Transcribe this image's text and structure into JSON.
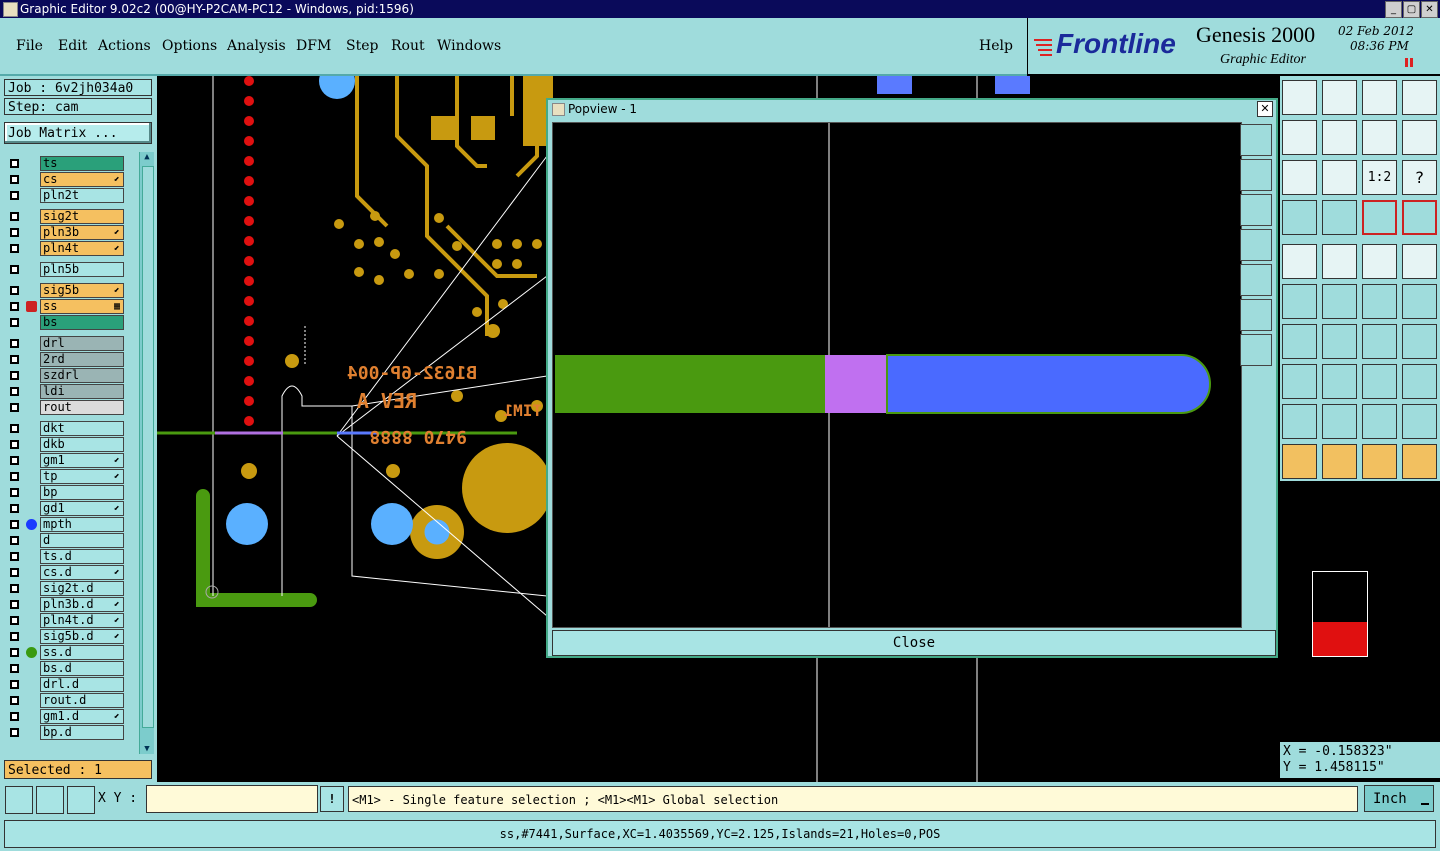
{
  "window": {
    "title": "Graphic Editor 9.02c2 (00@HY-P2CAM-PC12 - Windows, pid:1596)"
  },
  "menu": [
    "File",
    "Edit",
    "Actions",
    "Options",
    "Analysis",
    "DFM",
    "Step",
    "Rout",
    "Windows"
  ],
  "help_label": "Help",
  "brand": {
    "logo": "Frontline",
    "product": "Genesis 2000",
    "subtitle": "Graphic Editor",
    "date": "02 Feb 2012",
    "time": "08:36 PM"
  },
  "job": {
    "label": "Job : 6v2jh034a0",
    "step": "Step: cam",
    "matrix_button": "Job Matrix ..."
  },
  "layers": [
    {
      "name": "ts",
      "color": "#2aa07a",
      "flag": ""
    },
    {
      "name": "cs",
      "color": "#f5c060",
      "flag": "⬋"
    },
    {
      "name": "pln2t",
      "color": "#a8e4e4",
      "flag": ""
    },
    {
      "name": "sig2t",
      "color": "#f5c060",
      "flag": ""
    },
    {
      "name": "pln3b",
      "color": "#f5c060",
      "flag": "⬋"
    },
    {
      "name": "pln4t",
      "color": "#f5c060",
      "flag": "⬋"
    },
    {
      "name": "pln5b",
      "color": "#a8e4e4",
      "flag": ""
    },
    {
      "name": "sig5b",
      "color": "#f5c060",
      "flag": "⬋"
    },
    {
      "name": "ss",
      "color": "#f5c060",
      "flag": "▦"
    },
    {
      "name": "bs",
      "color": "#2aa07a",
      "flag": ""
    },
    {
      "name": "drl",
      "color": "#9ab4b4",
      "flag": ""
    },
    {
      "name": "2rd",
      "color": "#9ab4b4",
      "flag": ""
    },
    {
      "name": "szdrl",
      "color": "#9ab4b4",
      "flag": ""
    },
    {
      "name": "ldi",
      "color": "#9ab4b4",
      "flag": ""
    },
    {
      "name": "rout",
      "color": "#dcdcdc",
      "flag": ""
    },
    {
      "name": "dkt",
      "color": "#a8e4e4",
      "flag": ""
    },
    {
      "name": "dkb",
      "color": "#a8e4e4",
      "flag": ""
    },
    {
      "name": "gm1",
      "color": "#a8e4e4",
      "flag": "⬋"
    },
    {
      "name": "tp",
      "color": "#a8e4e4",
      "flag": "⬋"
    },
    {
      "name": "bp",
      "color": "#a8e4e4",
      "flag": ""
    },
    {
      "name": "gd1",
      "color": "#a8e4e4",
      "flag": "⬋"
    },
    {
      "name": "mpth",
      "color": "#a8e4e4",
      "flag": ""
    },
    {
      "name": "d",
      "color": "#a8e4e4",
      "flag": ""
    },
    {
      "name": "ts.d",
      "color": "#a8e4e4",
      "flag": ""
    },
    {
      "name": "cs.d",
      "color": "#a8e4e4",
      "flag": "⬋"
    },
    {
      "name": "sig2t.d",
      "color": "#a8e4e4",
      "flag": ""
    },
    {
      "name": "pln3b.d",
      "color": "#a8e4e4",
      "flag": "⬋"
    },
    {
      "name": "pln4t.d",
      "color": "#a8e4e4",
      "flag": "⬋"
    },
    {
      "name": "sig5b.d",
      "color": "#a8e4e4",
      "flag": "⬋"
    },
    {
      "name": "ss.d",
      "color": "#a8e4e4",
      "flag": ""
    },
    {
      "name": "bs.d",
      "color": "#a8e4e4",
      "flag": ""
    },
    {
      "name": "drl.d",
      "color": "#a8e4e4",
      "flag": ""
    },
    {
      "name": "rout.d",
      "color": "#a8e4e4",
      "flag": ""
    },
    {
      "name": "gm1.d",
      "color": "#a8e4e4",
      "flag": "⬋"
    },
    {
      "name": "bp.d",
      "color": "#a8e4e4",
      "flag": ""
    }
  ],
  "selected_label": "Selected : 1",
  "popview": {
    "title": "Popview - 1",
    "close_label": "Close"
  },
  "pcb_text": {
    "line1": "B1632-6P-004",
    "line2": "REV A",
    "line3": "9470 8888",
    "line4": "TIM1"
  },
  "coords": {
    "x": "X = -0.158323\"",
    "y": "Y = 1.458115\""
  },
  "xy_label": "X Y :",
  "xy_value": "",
  "prompt": "<M1> - Single feature selection ; <M1><M1> Global selection",
  "units": "Inch",
  "status": "ss,#7441,Surface,XC=1.4035569,YC=2.125,Islands=21,Holes=0,POS"
}
